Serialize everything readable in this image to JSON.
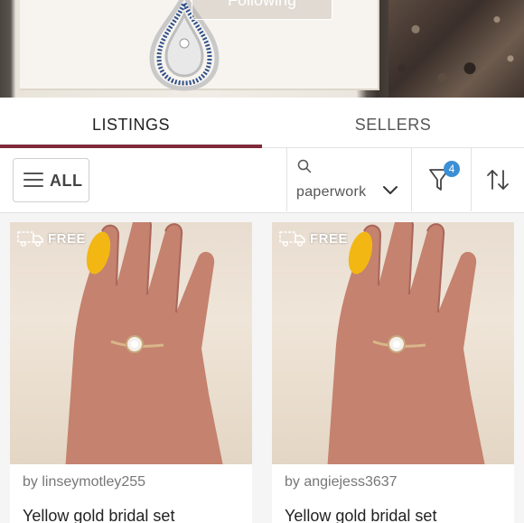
{
  "header": {
    "follow_label": "Following"
  },
  "tabs": [
    {
      "label": "LISTINGS",
      "active": true
    },
    {
      "label": "SELLERS",
      "active": false
    }
  ],
  "filters": {
    "category_label": "ALL",
    "search_term": "paperwork",
    "filter_count": "4"
  },
  "colors": {
    "accent": "#7f2a3a",
    "badge": "#3b8fd4"
  },
  "listings": [
    {
      "shipping": "FREE",
      "seller": "by linseymotley255",
      "title": "Yellow gold bridal set"
    },
    {
      "shipping": "FREE",
      "seller": "by angiejess3637",
      "title": "Yellow gold bridal set"
    }
  ]
}
